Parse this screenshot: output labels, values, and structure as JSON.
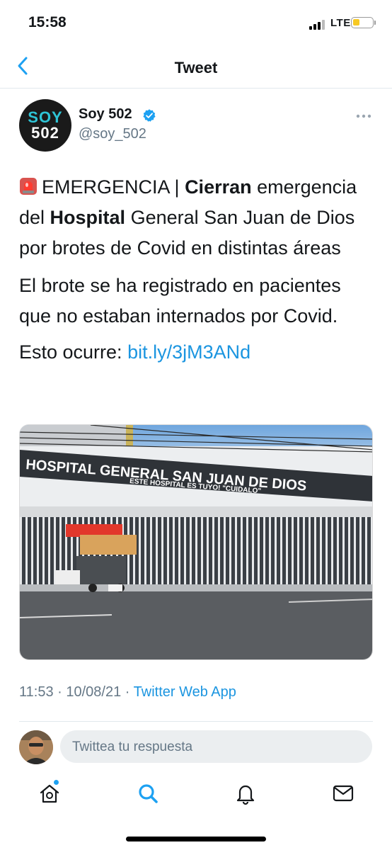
{
  "status_bar": {
    "time": "15:58",
    "network": "LTE"
  },
  "nav": {
    "title": "Tweet"
  },
  "author": {
    "avatar_line1": "SOY",
    "avatar_line2": "502",
    "name": "Soy 502",
    "handle": "@soy_502"
  },
  "tweet": {
    "p1_text1": "EMERGENCIA | ",
    "p1_bold1": "Cierran",
    "p1_text2": " emergencia del ",
    "p1_bold2": "Hospital",
    "p1_text3": " General San Juan de Dios por brotes de Covid en distintas áreas",
    "p2": "El brote se ha registrado en pacientes que no estaban internados por Covid.",
    "p3_text": "Esto ocurre: ",
    "p3_link": "bit.ly/3jM3ANd"
  },
  "photo": {
    "sign_line1": "HOSPITAL GENERAL SAN JUAN DE DIOS",
    "sign_line2": "ESTE HOSPITAL ES TUYO! \"CUIDALO\""
  },
  "meta": {
    "time": "11:53",
    "sep1": " · ",
    "date": "10/08/21",
    "sep2": " · ",
    "app": "Twitter Web App"
  },
  "reply": {
    "placeholder": "Twittea tu respuesta"
  },
  "colors": {
    "accent": "#1da1f2",
    "link": "#1b95e0",
    "secondary_text": "#657786",
    "brand_teal": "#2ec4d6"
  },
  "icons": {
    "back": "chevron-left-icon",
    "verified": "verified-badge-icon",
    "more": "more-icon",
    "siren": "siren-emoji-icon",
    "tabs": [
      "home-icon",
      "search-icon",
      "notifications-icon",
      "messages-icon"
    ]
  }
}
